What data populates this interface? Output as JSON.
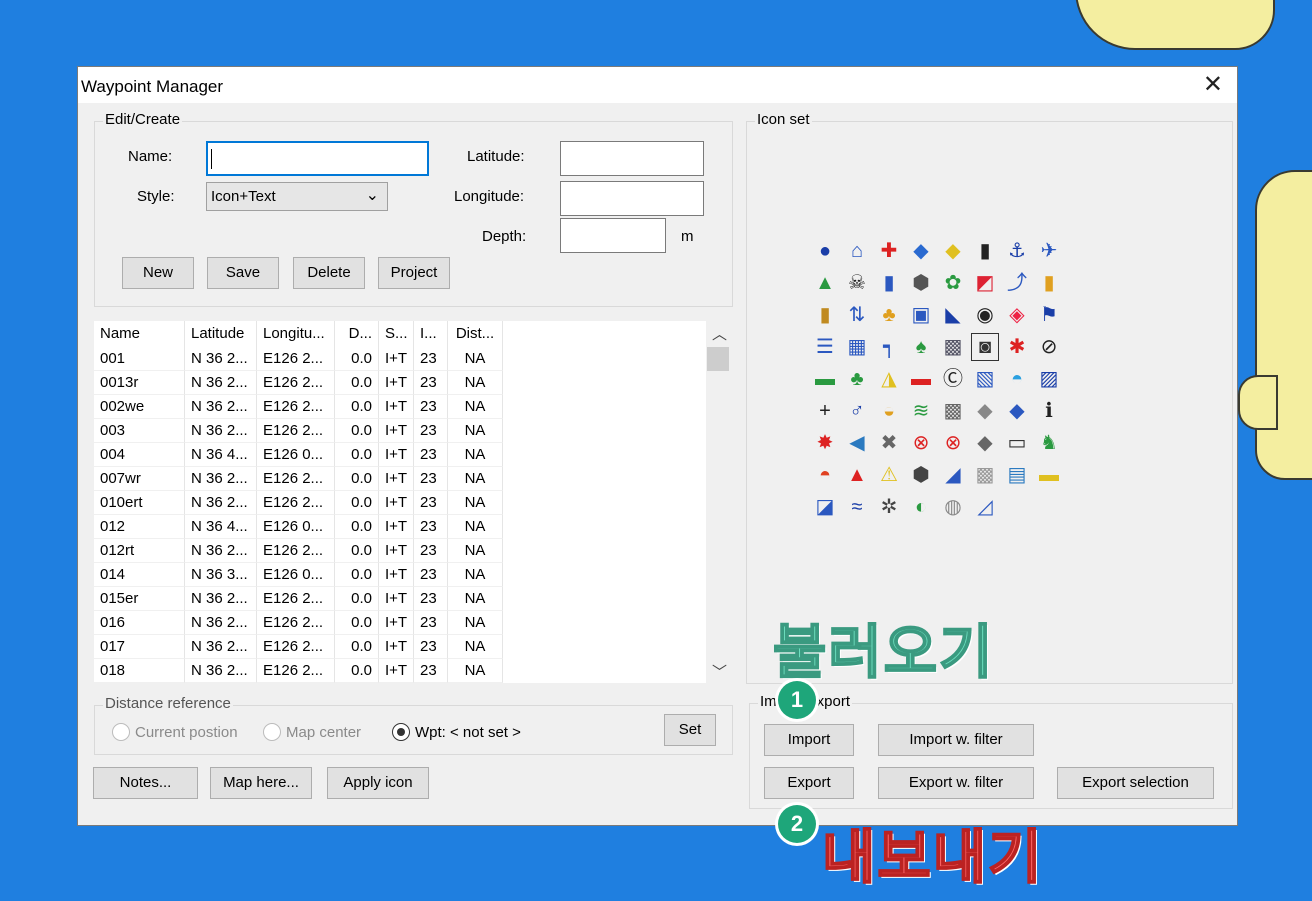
{
  "window": {
    "title": "Waypoint Manager",
    "close_glyph": "✕"
  },
  "edit": {
    "legend": "Edit/Create",
    "name_label": "Name:",
    "name_value": "",
    "style_label": "Style:",
    "style_value": "Icon+Text",
    "latitude_label": "Latitude:",
    "longitude_label": "Longitude:",
    "depth_label": "Depth:",
    "depth_unit": "m",
    "buttons": {
      "new": "New",
      "save": "Save",
      "delete": "Delete",
      "project": "Project"
    }
  },
  "table": {
    "columns": [
      "Name",
      "Latitude",
      "Longitu...",
      "D...",
      "S...",
      "I...",
      "Dist..."
    ],
    "rows": [
      [
        "001",
        "N 36 2...",
        "E126 2...",
        "0.0",
        "I+T",
        "23",
        "NA"
      ],
      [
        "0013r",
        "N 36 2...",
        "E126 2...",
        "0.0",
        "I+T",
        "23",
        "NA"
      ],
      [
        "002we",
        "N 36 2...",
        "E126 2...",
        "0.0",
        "I+T",
        "23",
        "NA"
      ],
      [
        "003",
        "N 36 2...",
        "E126 2...",
        "0.0",
        "I+T",
        "23",
        "NA"
      ],
      [
        "004",
        "N 36 4...",
        "E126 0...",
        "0.0",
        "I+T",
        "23",
        "NA"
      ],
      [
        "007wr",
        "N 36 2...",
        "E126 2...",
        "0.0",
        "I+T",
        "23",
        "NA"
      ],
      [
        "010ert",
        "N 36 2...",
        "E126 2...",
        "0.0",
        "I+T",
        "23",
        "NA"
      ],
      [
        "012",
        "N 36 4...",
        "E126 0...",
        "0.0",
        "I+T",
        "23",
        "NA"
      ],
      [
        "012rt",
        "N 36 2...",
        "E126 2...",
        "0.0",
        "I+T",
        "23",
        "NA"
      ],
      [
        "014",
        "N 36 3...",
        "E126 0...",
        "0.0",
        "I+T",
        "23",
        "NA"
      ],
      [
        "015er",
        "N 36 2...",
        "E126 2...",
        "0.0",
        "I+T",
        "23",
        "NA"
      ],
      [
        "016",
        "N 36 2...",
        "E126 2...",
        "0.0",
        "I+T",
        "23",
        "NA"
      ],
      [
        "017",
        "N 36 2...",
        "E126 2...",
        "0.0",
        "I+T",
        "23",
        "NA"
      ],
      [
        "018",
        "N 36 2...",
        "E126 2...",
        "0.0",
        "I+T",
        "23",
        "NA"
      ]
    ]
  },
  "distance": {
    "legend": "Distance reference",
    "current_position": "Current postion",
    "map_center": "Map center",
    "wpt": "Wpt: < not set >",
    "set_button": "Set"
  },
  "bottom_buttons": {
    "notes": "Notes...",
    "map_here": "Map here...",
    "apply_icon": "Apply icon"
  },
  "iconset": {
    "legend": "Icon set",
    "icons": [
      {
        "name": "circle-icon",
        "glyph": "●",
        "color": "#1a3ea8"
      },
      {
        "name": "house-icon",
        "glyph": "⌂",
        "color": "#2b58c0"
      },
      {
        "name": "cross-icon",
        "glyph": "✚",
        "color": "#d22"
      },
      {
        "name": "fish-icon",
        "glyph": "◆",
        "color": "#2a6ad0"
      },
      {
        "name": "duck-icon",
        "glyph": "◆",
        "color": "#e0c020"
      },
      {
        "name": "lighthouse-icon",
        "glyph": "▮",
        "color": "#222"
      },
      {
        "name": "anchor-icon",
        "glyph": "⚓",
        "color": "#1a3ea8"
      },
      {
        "name": "airplane-icon",
        "glyph": "✈",
        "color": "#2b58c0"
      },
      {
        "name": "tent-icon",
        "glyph": "▲",
        "color": "#2a9a40"
      },
      {
        "name": "skull-icon",
        "glyph": "☠",
        "color": "#222"
      },
      {
        "name": "fuel-icon",
        "glyph": "▮",
        "color": "#2b58c0"
      },
      {
        "name": "rock-icon",
        "glyph": "⬢",
        "color": "#555"
      },
      {
        "name": "weed-icon",
        "glyph": "✿",
        "color": "#2a9a40"
      },
      {
        "name": "flag-diag-icon",
        "glyph": "◩",
        "color": "#d23"
      },
      {
        "name": "hook-icon",
        "glyph": "⤴",
        "color": "#2b58c0"
      },
      {
        "name": "mug-icon",
        "glyph": "▮",
        "color": "#e0a020"
      },
      {
        "name": "bottle-icon",
        "glyph": "▮",
        "color": "#c08a20"
      },
      {
        "name": "arrows-icon",
        "glyph": "⇅",
        "color": "#2b58c0"
      },
      {
        "name": "people-icon",
        "glyph": "♣",
        "color": "#e0a020"
      },
      {
        "name": "c-box-icon",
        "glyph": "▣",
        "color": "#2b58c0"
      },
      {
        "name": "sail-icon",
        "glyph": "◣",
        "color": "#1a3ea8"
      },
      {
        "name": "target-icon",
        "glyph": "◉",
        "color": "#222"
      },
      {
        "name": "diamond-icon",
        "glyph": "◈",
        "color": "#e24"
      },
      {
        "name": "blue-flag-icon",
        "glyph": "⚑",
        "color": "#1a3ea8"
      },
      {
        "name": "list-icon",
        "glyph": "☰",
        "color": "#2b58c0"
      },
      {
        "name": "shower-icon",
        "glyph": "▦",
        "color": "#2b58c0"
      },
      {
        "name": "faucet-icon",
        "glyph": "┑",
        "color": "#2b58c0"
      },
      {
        "name": "tree-icon",
        "glyph": "♠",
        "color": "#2a9a40"
      },
      {
        "name": "grid-icon",
        "glyph": "▩",
        "color": "#556"
      },
      {
        "name": "camera-icon",
        "glyph": "◙",
        "color": "#333"
      },
      {
        "name": "diver-icon",
        "glyph": "✱",
        "color": "#d22"
      },
      {
        "name": "no-entry-icon",
        "glyph": "⊘",
        "color": "#222"
      },
      {
        "name": "turtle-icon",
        "glyph": "▬",
        "color": "#2a9a40"
      },
      {
        "name": "island-icon",
        "glyph": "♣",
        "color": "#2a9a40"
      },
      {
        "name": "beacon-icon",
        "glyph": "◮",
        "color": "#e0c020"
      },
      {
        "name": "car-icon",
        "glyph": "▬",
        "color": "#d22"
      },
      {
        "name": "c-mark-icon",
        "glyph": "Ⓒ",
        "color": "#222"
      },
      {
        "name": "map-icon",
        "glyph": "▧",
        "color": "#2b58c0"
      },
      {
        "name": "fountain-icon",
        "glyph": "◓",
        "color": "#2aa0e0"
      },
      {
        "name": "wave-icon",
        "glyph": "▨",
        "color": "#1a3ea8"
      },
      {
        "name": "plus-icon",
        "glyph": "+",
        "color": "#222"
      },
      {
        "name": "swimmer-icon",
        "glyph": "♂",
        "color": "#1a3ea8"
      },
      {
        "name": "bowl-icon",
        "glyph": "◒",
        "color": "#e0a020"
      },
      {
        "name": "seaweed-icon",
        "glyph": "≋",
        "color": "#2a9a40"
      },
      {
        "name": "reef-icon",
        "glyph": "▩",
        "color": "#666"
      },
      {
        "name": "bird-icon",
        "glyph": "◆",
        "color": "#888"
      },
      {
        "name": "cube-icon",
        "glyph": "◆",
        "color": "#2b58c0"
      },
      {
        "name": "info-icon",
        "glyph": "ℹ",
        "color": "#222"
      },
      {
        "name": "lobster-icon",
        "glyph": "✸",
        "color": "#d22"
      },
      {
        "name": "shark-icon",
        "glyph": "◀",
        "color": "#2b7ac0"
      },
      {
        "name": "wreck-icon",
        "glyph": "✖",
        "color": "#666"
      },
      {
        "name": "no-anchor-icon",
        "glyph": "⊗",
        "color": "#d22"
      },
      {
        "name": "no-fishing-icon",
        "glyph": "⊗",
        "color": "#d22"
      },
      {
        "name": "fish-gray-icon",
        "glyph": "◆",
        "color": "#666"
      },
      {
        "name": "bench-icon",
        "glyph": "▭",
        "color": "#333"
      },
      {
        "name": "sitting-icon",
        "glyph": "♞",
        "color": "#2a9a40"
      },
      {
        "name": "boat-red-icon",
        "glyph": "◓",
        "color": "#e04020"
      },
      {
        "name": "sunset-icon",
        "glyph": "▲",
        "color": "#d22"
      },
      {
        "name": "warning-icon",
        "glyph": "⚠",
        "color": "#e0c020"
      },
      {
        "name": "stones-icon",
        "glyph": "⬢",
        "color": "#444"
      },
      {
        "name": "marlin-icon",
        "glyph": "◢",
        "color": "#2b58c0"
      },
      {
        "name": "coral-icon",
        "glyph": "▩",
        "color": "#999"
      },
      {
        "name": "pool-icon",
        "glyph": "▤",
        "color": "#2b7ac0"
      },
      {
        "name": "raft-icon",
        "glyph": "▬",
        "color": "#e0c020"
      },
      {
        "name": "knife-icon",
        "glyph": "◪",
        "color": "#2b58c0"
      },
      {
        "name": "swim-icon",
        "glyph": "≈",
        "color": "#1a3ea8"
      },
      {
        "name": "gear-icon",
        "glyph": "✲",
        "color": "#444"
      },
      {
        "name": "ring-icon",
        "glyph": "◐",
        "color": "#2a9a40"
      },
      {
        "name": "shell-icon",
        "glyph": "◍",
        "color": "#888"
      },
      {
        "name": "ski-icon",
        "glyph": "◿",
        "color": "#2b58c0"
      }
    ]
  },
  "import_export": {
    "legend": "Import/Export",
    "import": "Import",
    "import_filter": "Import w. filter",
    "export": "Export",
    "export_filter": "Export w. filter",
    "export_selection": "Export selection"
  },
  "annotations": {
    "badge1": "1",
    "badge2": "2",
    "import_korean": "불러오기",
    "export_korean": "내보내기"
  }
}
